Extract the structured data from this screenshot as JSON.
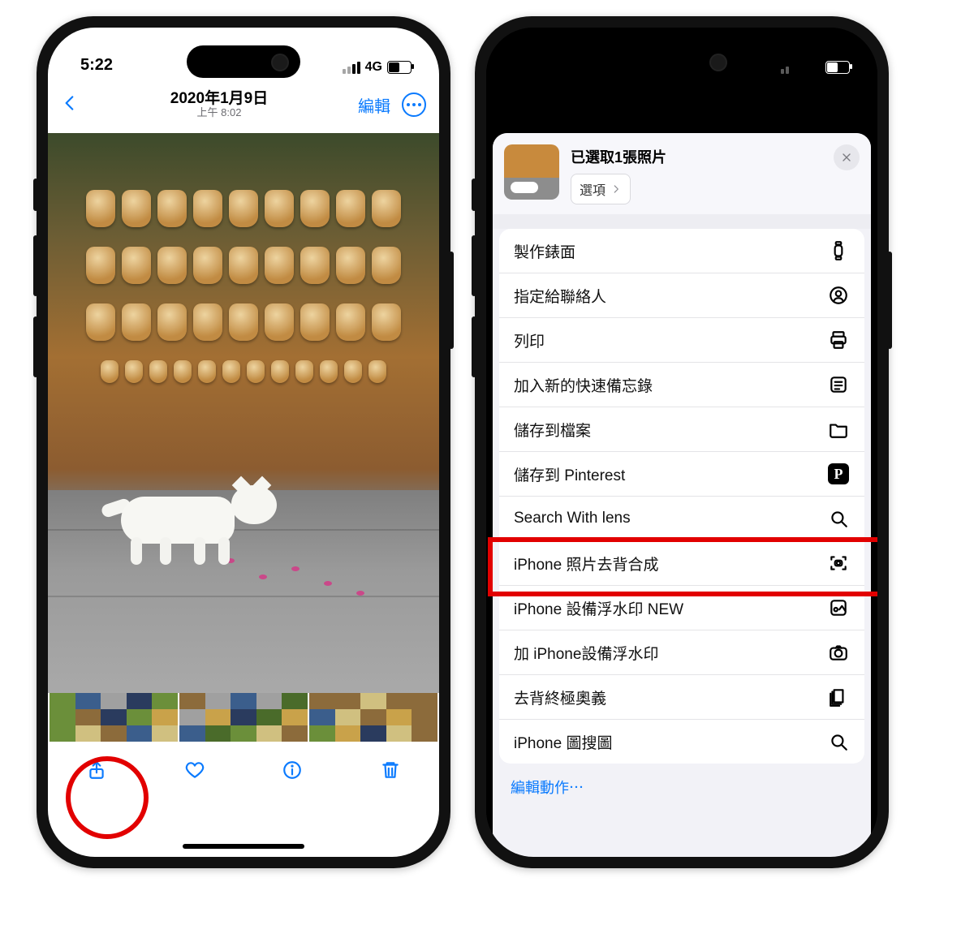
{
  "status": {
    "time": "5:22",
    "network": "4G"
  },
  "photosDetail": {
    "dateLine": "2020年1月9日",
    "timeLine": "上午 8:02",
    "editLabel": "編輯"
  },
  "shareSheet": {
    "title": "已選取1張照片",
    "optionsLabel": "選項",
    "editActionsLabel": "編輯動作⋯",
    "actions": [
      {
        "label": "製作錶面",
        "icon": "watch"
      },
      {
        "label": "指定給聯絡人",
        "icon": "contact"
      },
      {
        "label": "列印",
        "icon": "print"
      },
      {
        "label": "加入新的快速備忘錄",
        "icon": "note"
      },
      {
        "label": "儲存到檔案",
        "icon": "folder"
      },
      {
        "label": "儲存到 Pinterest",
        "icon": "pinterest"
      },
      {
        "label": "Search With lens",
        "icon": "search"
      },
      {
        "label": "iPhone 照片去背合成",
        "icon": "scan-camera"
      },
      {
        "label": "iPhone 設備浮水印 NEW",
        "icon": "watermark"
      },
      {
        "label": "加 iPhone設備浮水印",
        "icon": "camera"
      },
      {
        "label": "去背終極奧義",
        "icon": "stack"
      },
      {
        "label": "iPhone 圖搜圖",
        "icon": "search"
      }
    ],
    "highlightIndex": 7
  }
}
